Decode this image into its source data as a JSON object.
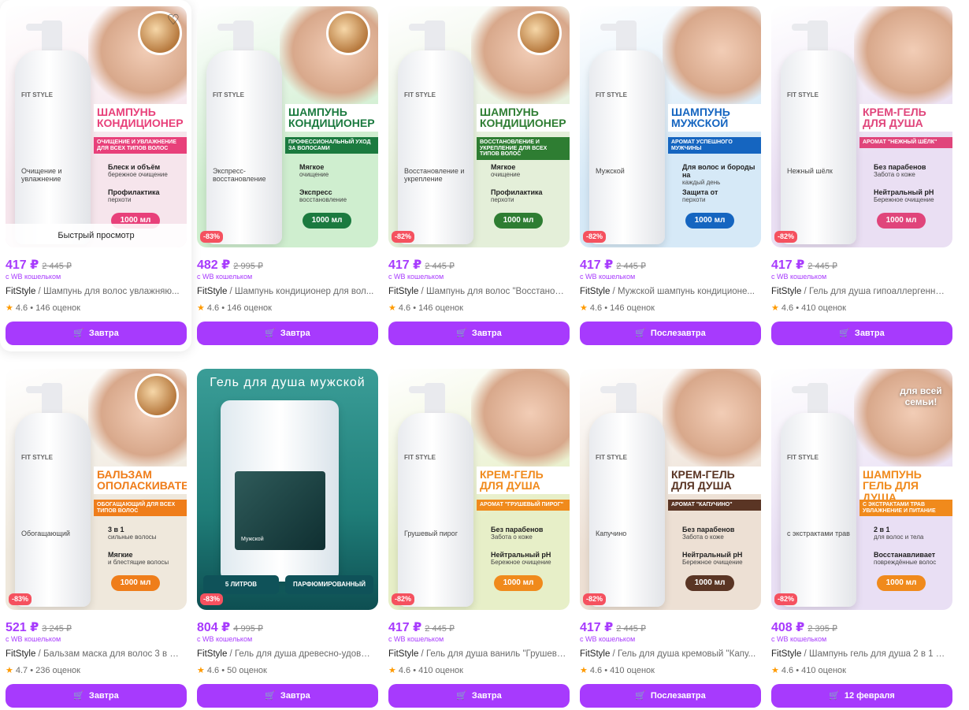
{
  "common": {
    "wallet_label": "с WB кошельком",
    "quick_view": "Быстрый просмотр",
    "currency": "₽"
  },
  "products": [
    {
      "price": "417 ₽",
      "old_price": "2 445 ₽",
      "brand": "FitStyle",
      "name": "Шампунь для волос увлажняю...",
      "rating": "4.6",
      "reviews": "146 оценок",
      "delivery": "Завтра",
      "discount": "",
      "image": {
        "bg": "#f6e5ec",
        "accent": "#e8407a",
        "title": "Шампунь кондиционер",
        "subtitle": "Очищение и увлажнение для всех типов волос",
        "bottle_brand": "FIT STYLE",
        "bottle_label": "Очищение и увлажнение",
        "f1": "Блеск и объём",
        "f1s": "бережное очищение",
        "f2": "Профилактика",
        "f2s": "перхоти",
        "volume": "1000 мл"
      }
    },
    {
      "price": "482 ₽",
      "old_price": "2 995 ₽",
      "brand": "FitStyle",
      "name": "Шампунь кондиционер для вол...",
      "rating": "4.6",
      "reviews": "146 оценок",
      "delivery": "Завтра",
      "discount": "-83%",
      "image": {
        "bg": "#cfeecf",
        "accent": "#1b7a3f",
        "title": "Шампунь кондиционер",
        "subtitle": "Профессиональный уход за волосами",
        "bottle_brand": "FIT STYLE",
        "bottle_label": "Экспресс-восстановление",
        "f1": "Мягкое",
        "f1s": "очищение",
        "f2": "Экспресс",
        "f2s": "восстановление",
        "volume": "1000 мл"
      }
    },
    {
      "price": "417 ₽",
      "old_price": "2 445 ₽",
      "brand": "FitStyle",
      "name": "Шампунь для волос \"Восстанов...",
      "rating": "4.6",
      "reviews": "146 оценок",
      "delivery": "Завтра",
      "discount": "-82%",
      "image": {
        "bg": "#e4efd9",
        "accent": "#2e7d32",
        "title": "Шампунь кондиционер",
        "subtitle": "Восстановление и укрепление для всех типов волос",
        "bottle_brand": "FIT STYLE",
        "bottle_label": "Восстановление и укрепление",
        "f1": "Мягкое",
        "f1s": "очищение",
        "f2": "Профилактика",
        "f2s": "перхоти",
        "volume": "1000 мл"
      }
    },
    {
      "price": "417 ₽",
      "old_price": "2 445 ₽",
      "brand": "FitStyle",
      "name": "Мужской шампунь кондиционе...",
      "rating": "4.6",
      "reviews": "146 оценок",
      "delivery": "Послезавтра",
      "discount": "-82%",
      "image": {
        "bg": "#d6e9f7",
        "accent": "#1565c0",
        "title": "Шампунь мужской",
        "subtitle": "Аромат успешного мужчины",
        "bottle_brand": "FIT STYLE",
        "bottle_label": "Мужской",
        "f1": "Для волос и бороды на",
        "f1s": "каждый день",
        "f2": "Защита от",
        "f2s": "перхоти",
        "volume": "1000 мл"
      }
    },
    {
      "price": "417 ₽",
      "old_price": "2 445 ₽",
      "brand": "FitStyle",
      "name": "Гель для душа гипоаллергенны...",
      "rating": "4.6",
      "reviews": "410 оценок",
      "delivery": "Завтра",
      "discount": "-82%",
      "image": {
        "bg": "#eadff3",
        "accent": "#e0457b",
        "title": "Крем-гель для душа",
        "subtitle": "Аромат \"нежный шёлк\"",
        "bottle_brand": "FIT STYLE",
        "bottle_label": "Нежный шёлк",
        "f1": "Без парабенов",
        "f1s": "Забота о коже",
        "f2": "Нейтральный pH",
        "f2s": "Бережное очищение",
        "volume": "1000 мл"
      }
    },
    {
      "price": "521 ₽",
      "old_price": "3 245 ₽",
      "brand": "FitStyle",
      "name": "Бальзам маска для волос 3 в 1 \"...",
      "rating": "4.7",
      "reviews": "236 оценок",
      "delivery": "Завтра",
      "discount": "-83%",
      "image": {
        "bg": "#efe8dc",
        "accent": "#ef7d1a",
        "title": "Бальзам ополаскиватель",
        "subtitle": "Обогащающий для всех типов волос",
        "bottle_brand": "FIT STYLE",
        "bottle_label": "Обогащающий",
        "f1": "3 в 1",
        "f1s": "сильные волосы",
        "f2": "Мягкие",
        "f2s": "и блестящие волосы",
        "volume": "1000 мл"
      }
    },
    {
      "price": "804 ₽",
      "old_price": "4 995 ₽",
      "brand": "FitStyle",
      "name": "Гель для душа древесно-удовы...",
      "rating": "4.6",
      "reviews": "50 оценок",
      "delivery": "Завтра",
      "discount": "-83%",
      "image": {
        "bg": "#2d8b86",
        "accent": "#0f5259",
        "title": "Гель для душа мужской",
        "subtitle": "",
        "bottle_brand": "",
        "bottle_label": "Мужской",
        "f1": "",
        "f1s": "",
        "f2": "",
        "f2s": "",
        "volume": "",
        "tag1": "5 литров",
        "tag2": "Парфюмированный"
      }
    },
    {
      "price": "417 ₽",
      "old_price": "2 445 ₽",
      "brand": "FitStyle",
      "name": "Гель для душа ваниль \"Грушевы...",
      "rating": "4.6",
      "reviews": "410 оценок",
      "delivery": "Завтра",
      "discount": "-82%",
      "image": {
        "bg": "#e7efc8",
        "accent": "#f08a1c",
        "title": "Крем-гель для душа",
        "subtitle": "Аромат \"Грушевый пирог\"",
        "bottle_brand": "FIT STYLE",
        "bottle_label": "Грушевый пирог",
        "f1": "Без парабенов",
        "f1s": "Забота о коже",
        "f2": "Нейтральный pH",
        "f2s": "Бережное очищение",
        "volume": "1000 мл"
      }
    },
    {
      "price": "417 ₽",
      "old_price": "2 445 ₽",
      "brand": "FitStyle",
      "name": "Гель для душа кремовый \"Капу...",
      "rating": "4.6",
      "reviews": "410 оценок",
      "delivery": "Послезавтра",
      "discount": "-82%",
      "image": {
        "bg": "#ede0d4",
        "accent": "#5a3524",
        "title": "Крем-гель для душа",
        "subtitle": "Аромат \"Капучино\"",
        "bottle_brand": "FIT STYLE",
        "bottle_label": "Капучино",
        "f1": "Без парабенов",
        "f1s": "Забота о коже",
        "f2": "Нейтральный pH",
        "f2s": "Бережное очищение",
        "volume": "1000 мл"
      }
    },
    {
      "price": "408 ₽",
      "old_price": "2 395 ₽",
      "brand": "FitStyle",
      "name": "Шампунь гель для душа 2 в 1 с ...",
      "rating": "4.6",
      "reviews": "410 оценок",
      "delivery": "12 февраля",
      "discount": "-82%",
      "image": {
        "bg": "#e9dff4",
        "accent": "#f08a1c",
        "title": "Шампунь гель для душа",
        "subtitle": "С экстрактами трав увлажнение и питание",
        "bottle_brand": "FIT STYLE",
        "bottle_label": "с экстрактами трав",
        "f1": "2 в 1",
        "f1s": "для волос и тела",
        "f2": "Восстанавливает",
        "f2s": "повреждённые волос",
        "volume": "1000 мл",
        "badge": "для всей семьи!"
      }
    }
  ]
}
